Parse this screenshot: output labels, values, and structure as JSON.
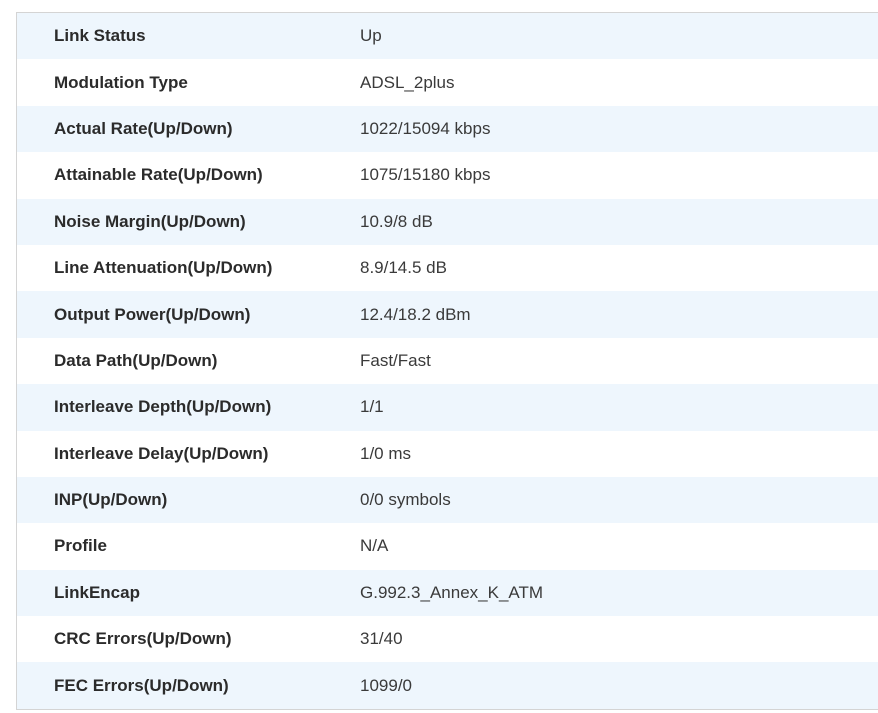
{
  "dsl_status": {
    "rows": [
      {
        "label": "Link Status",
        "value": "Up"
      },
      {
        "label": "Modulation Type",
        "value": "ADSL_2plus"
      },
      {
        "label": "Actual Rate(Up/Down)",
        "value": "1022/15094 kbps"
      },
      {
        "label": "Attainable Rate(Up/Down)",
        "value": "1075/15180 kbps"
      },
      {
        "label": "Noise Margin(Up/Down)",
        "value": "10.9/8 dB"
      },
      {
        "label": "Line Attenuation(Up/Down)",
        "value": "8.9/14.5 dB"
      },
      {
        "label": "Output Power(Up/Down)",
        "value": "12.4/18.2 dBm"
      },
      {
        "label": "Data Path(Up/Down)",
        "value": "Fast/Fast"
      },
      {
        "label": "Interleave Depth(Up/Down)",
        "value": "1/1"
      },
      {
        "label": "Interleave Delay(Up/Down)",
        "value": "1/0 ms"
      },
      {
        "label": "INP(Up/Down)",
        "value": "0/0 symbols"
      },
      {
        "label": "Profile",
        "value": "N/A"
      },
      {
        "label": "LinkEncap",
        "value": "G.992.3_Annex_K_ATM"
      },
      {
        "label": "CRC Errors(Up/Down)",
        "value": "31/40"
      },
      {
        "label": "FEC Errors(Up/Down)",
        "value": "1099/0"
      }
    ]
  },
  "colors": {
    "row_alt_background": "#eef6fd",
    "row_background": "#ffffff",
    "border": "#d4d4d4",
    "label_text": "#2b2b2b",
    "value_text": "#3a3a3a"
  }
}
